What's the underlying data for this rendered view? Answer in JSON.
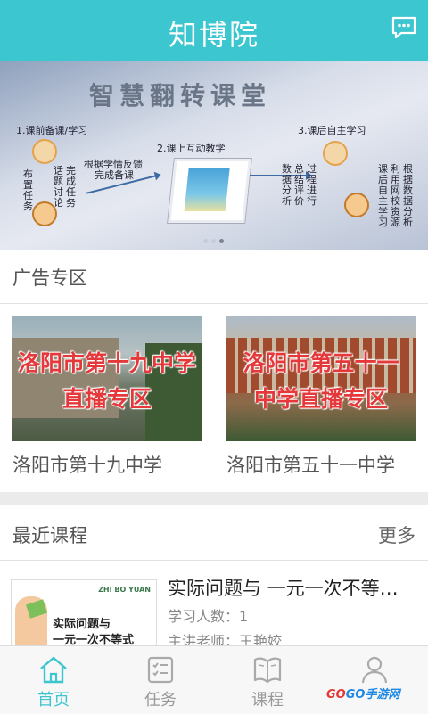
{
  "header": {
    "title": "知博院",
    "message_icon": "chat-bubble-icon"
  },
  "banner": {
    "title": "智慧翻转课堂",
    "step1": "1.课前备课/学习",
    "step2": "2.课上互动教学",
    "step3": "3.课后自主学习",
    "col_a": "布置任务",
    "col_b": "话题讨论",
    "col_c": "完成任务",
    "feedback": "根据学情反馈",
    "prepare": "完成备课",
    "col_d": "数据分析",
    "col_e": "总结评价",
    "col_f": "过程进行",
    "col_g": "课后自主学习",
    "col_h": "利用网校资源",
    "col_i": "根据数据分析",
    "page_dots": 3,
    "active_dot": 3
  },
  "ads": {
    "section_title": "广告专区",
    "items": [
      {
        "name": "洛阳市第十九中学",
        "overlay_line1": "洛阳市第十九中学",
        "overlay_line2": "直播专区"
      },
      {
        "name": "洛阳市第五十一中学",
        "overlay_line1": "洛阳市第五十一",
        "overlay_line2": "中学直播专区"
      }
    ]
  },
  "recent": {
    "section_title": "最近课程",
    "more_label": "更多",
    "course": {
      "title": "实际问题与 一元一次不等…",
      "learners": "学习人数：1",
      "teacher": "主讲老师：王艳姣",
      "thumb_logo": "ZHI BO YUAN",
      "thumb_line1": "实际问题与",
      "thumb_line2": "一元一次不等式"
    }
  },
  "tabs": [
    {
      "label": "首页",
      "icon": "home-icon",
      "active": true
    },
    {
      "label": "任务",
      "icon": "task-list-icon",
      "active": false
    },
    {
      "label": "课程",
      "icon": "book-icon",
      "active": false
    },
    {
      "label": "我的",
      "icon": "user-icon",
      "active": false
    }
  ],
  "watermark": {
    "text_a": "GO",
    "text_b": "GO",
    "text_c": "手游网"
  },
  "colors": {
    "accent": "#3cc6cf",
    "overlay_red": "#e5383b"
  }
}
